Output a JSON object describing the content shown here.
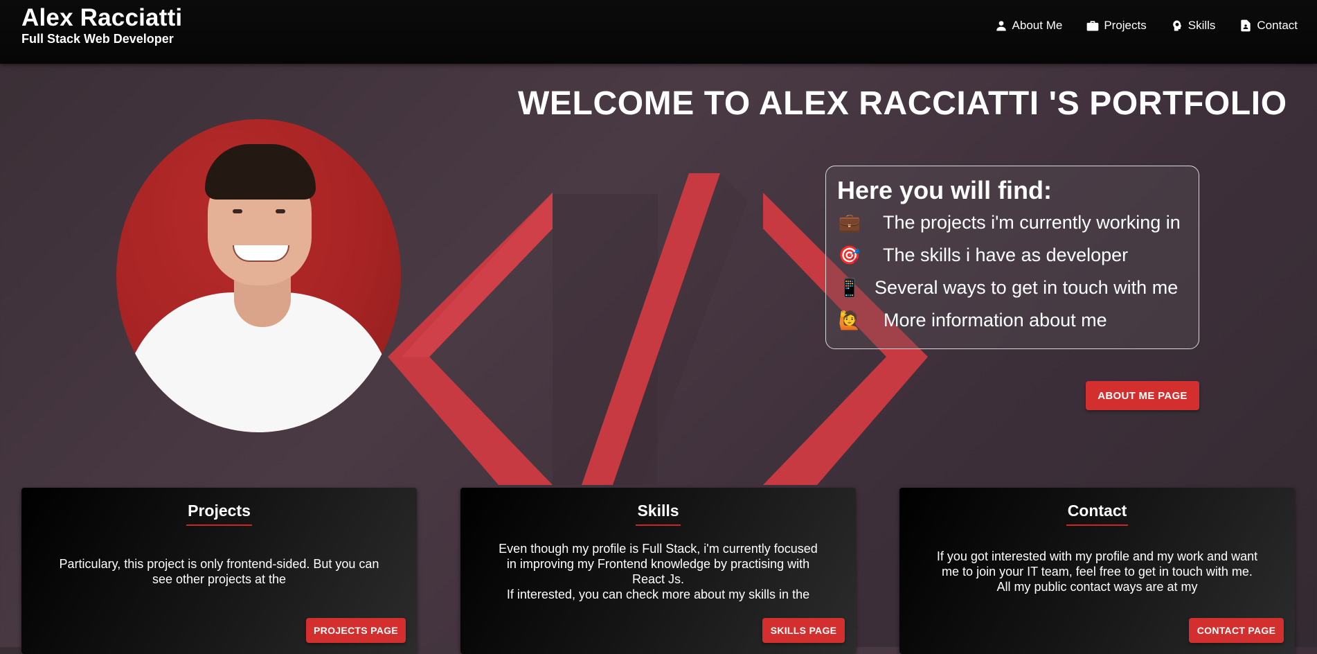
{
  "header": {
    "name": "Alex Racciatti",
    "subtitle": "Full Stack Web Developer",
    "nav": [
      {
        "label": "About Me",
        "icon": "person-icon"
      },
      {
        "label": "Projects",
        "icon": "briefcase-icon"
      },
      {
        "label": "Skills",
        "icon": "psychology-icon"
      },
      {
        "label": "Contact",
        "icon": "contact-page-icon"
      }
    ]
  },
  "hero": {
    "title": "WELCOME TO ALEX RACCIATTI 'S PORTFOLIO",
    "info_title": "Here you will find:",
    "info_items": [
      {
        "emoji": "💼",
        "text": "The projects i'm currently working in"
      },
      {
        "emoji": "🎯",
        "text": "The skills i have as developer"
      },
      {
        "emoji": "📱",
        "text": "Several ways to get in touch with me"
      },
      {
        "emoji": "🙋",
        "text": "More information about me"
      }
    ],
    "about_button": "About Me Page"
  },
  "cards": [
    {
      "title": "Projects",
      "lines": [
        "Particulary, this project is only frontend-sided. But you can",
        "see other projects at the"
      ],
      "button": "Projects Page"
    },
    {
      "title": "Skills",
      "lines": [
        "Even though my profile is Full Stack, i'm currently focused",
        "in improving my Frontend knowledge by practising with",
        "React Js.",
        "If interested, you can check more about my skills in the"
      ],
      "button": "Skills Page"
    },
    {
      "title": "Contact",
      "lines": [
        "If you got interested with my profile and my work and want",
        "me to join your IT team, feel free to get in touch with me.",
        "All my public contact ways are at my"
      ],
      "button": "Contact Page"
    }
  ],
  "colors": {
    "accent": "#d32f2f",
    "header_bg": "#080808",
    "page_bg": "#3f323b"
  }
}
